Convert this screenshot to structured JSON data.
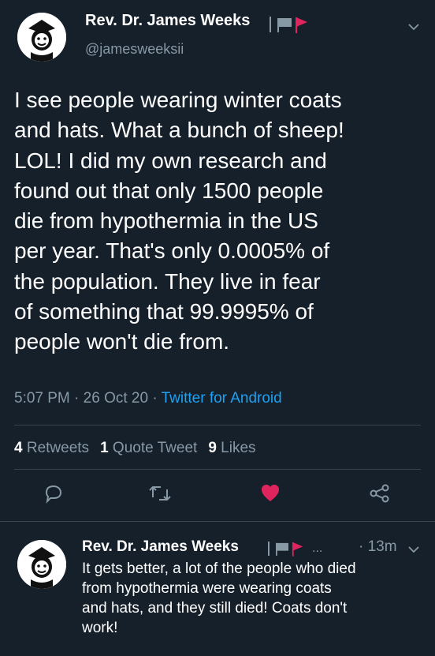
{
  "tweet": {
    "author_name": "Rev. Dr. James Weeks",
    "handle": "@jamesweeksii",
    "text": "I see people wearing winter coats\nand hats. What a bunch of sheep!\nLOL! I did my own research and\nfound out that only 1500 people\ndie from hypothermia in the US\nper year. That's only 0.0005% of\nthe population. They live in fear\nof something that 99.9995% of\npeople won't die from.",
    "time": "5:07 PM",
    "date": "26 Oct 20",
    "source": "Twitter for Android",
    "separator": " · ",
    "stats": {
      "retweets_count": "4",
      "retweets_label": "Retweets",
      "quotes_count": "1",
      "quotes_label": "Quote Tweet",
      "likes_count": "9",
      "likes_label": "Likes"
    },
    "colors": {
      "background": "#15202b",
      "secondary_text": "#8899a6",
      "link": "#1da1f2",
      "like_active": "#e0245e",
      "flag_red": "#e0245e"
    }
  },
  "reply": {
    "author_name": "Rev. Dr. James Weeks",
    "ellipsis": "...",
    "time_ago": "· 13m",
    "text": "It gets better, a lot of the people who died\nfrom hypothermia were wearing coats\nand hats, and they still died! Coats don't\nwork!"
  },
  "icons": {
    "reply": "reply-icon",
    "retweet": "retweet-icon",
    "like": "heart-icon",
    "share": "share-icon",
    "menu": "chevron-down-icon"
  }
}
